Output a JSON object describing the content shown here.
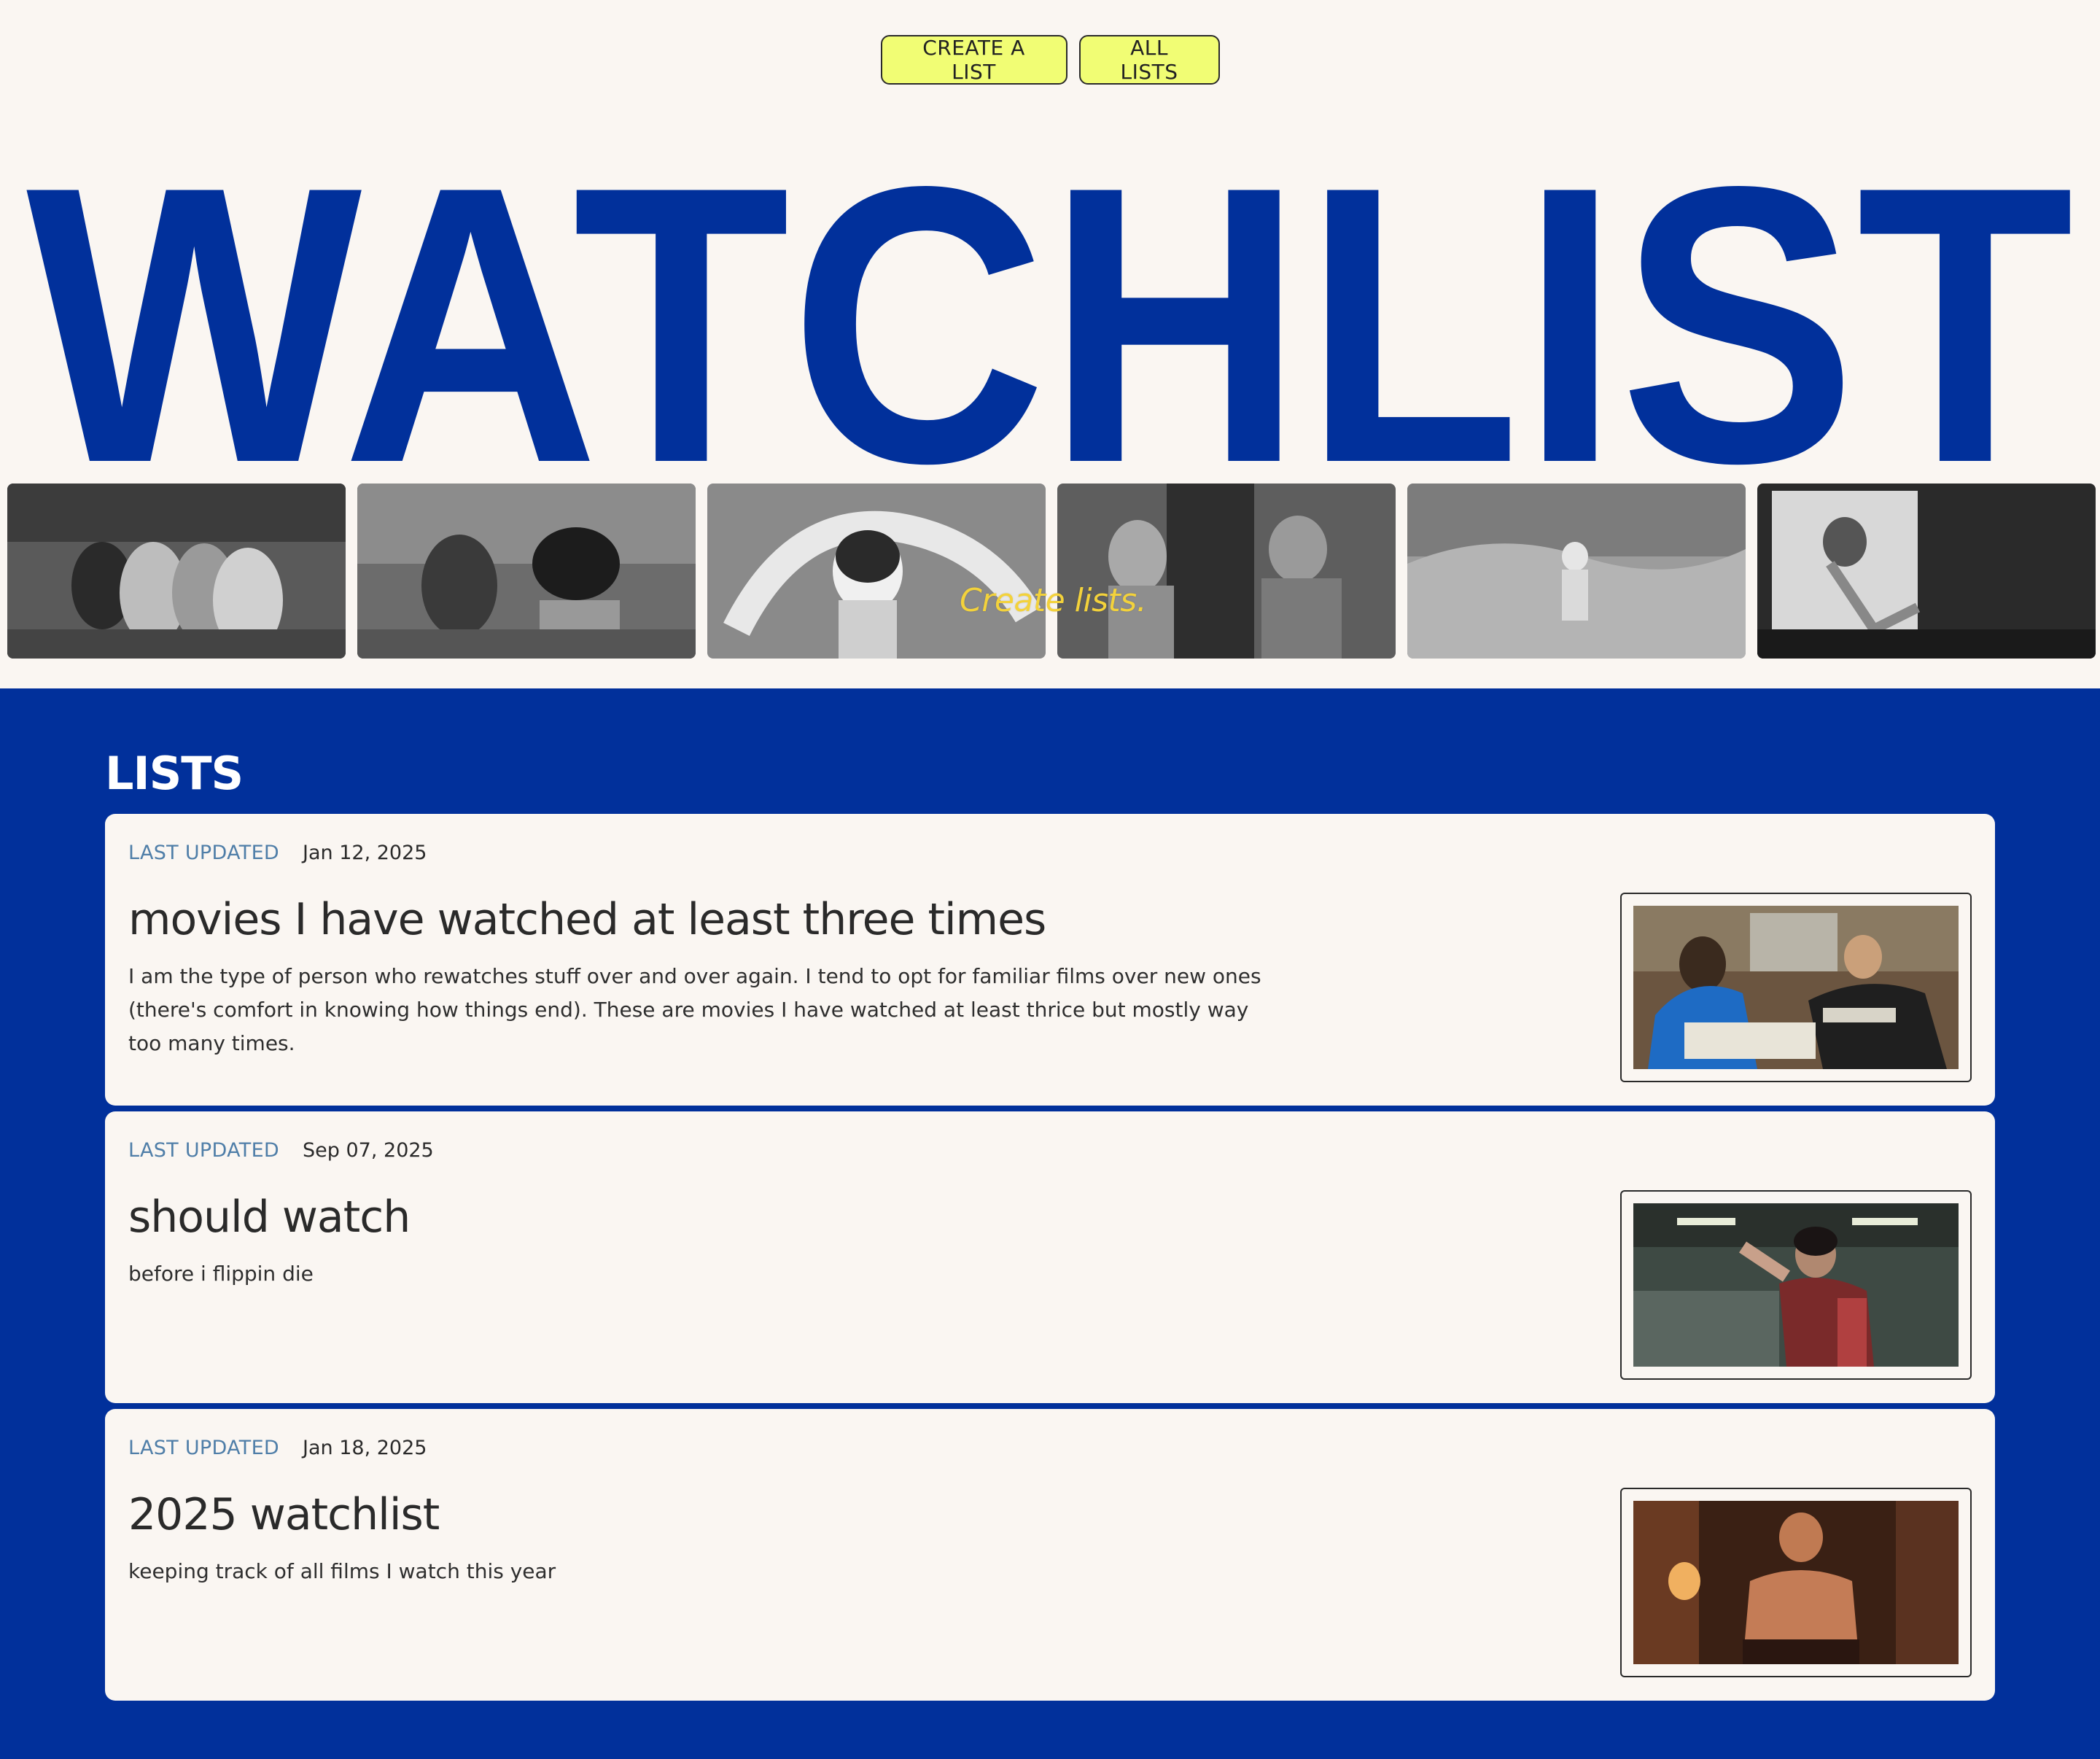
{
  "nav": {
    "create_label": "CREATE A  LIST",
    "all_label": "ALL  LISTS"
  },
  "hero": {
    "wordmark": "WATCHLIST",
    "tagline": "Create lists.",
    "brand_color": "#01309b",
    "accent_color": "#f1fd74",
    "stills": [
      "film-still-1",
      "film-still-2",
      "film-still-3",
      "film-still-4",
      "film-still-5",
      "film-still-6"
    ]
  },
  "lists": {
    "heading": "LISTS",
    "items": [
      {
        "meta_label": "LAST UPDATED",
        "date": "Jan 12, 2025",
        "title": "movies I have watched at least three times",
        "description": "I am the type of person who rewatches stuff over and over again.  I tend to opt for familiar films over new ones (there's comfort in knowing how things end). These are movies  I have watched at least thrice but mostly way too many times.",
        "thumbnail": "list-thumbnail"
      },
      {
        "meta_label": "LAST UPDATED",
        "date": "Sep 07, 2025",
        "title": "should watch",
        "description": "before i flippin die",
        "thumbnail": "list-thumbnail"
      },
      {
        "meta_label": "LAST UPDATED",
        "date": "Jan 18, 2025",
        "title": "2025 watchlist",
        "description": "keeping track of all films  I watch this year",
        "thumbnail": "list-thumbnail"
      }
    ]
  }
}
